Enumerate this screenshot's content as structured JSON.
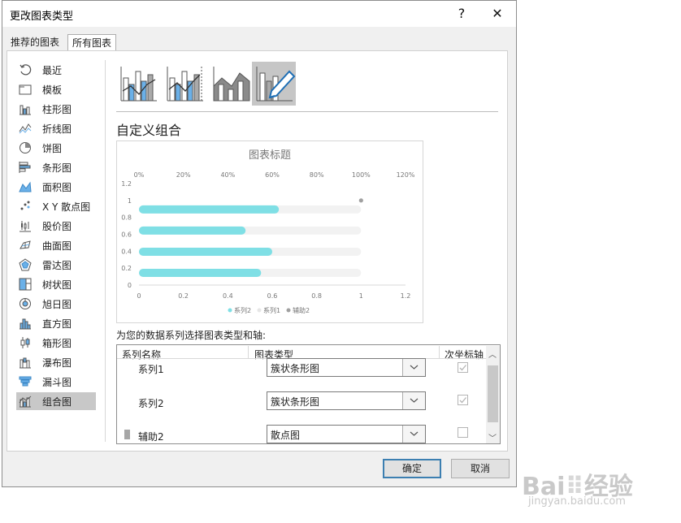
{
  "window": {
    "title": "更改图表类型",
    "help_label": "?",
    "close_label": "✕"
  },
  "tabs": [
    {
      "label": "推荐的图表"
    },
    {
      "label": "所有图表"
    }
  ],
  "sidebar": {
    "items": [
      {
        "label": "最近",
        "icon": "recent-icon"
      },
      {
        "label": "模板",
        "icon": "template-folder-icon"
      },
      {
        "label": "柱形图",
        "icon": "column-chart-icon"
      },
      {
        "label": "折线图",
        "icon": "line-chart-icon"
      },
      {
        "label": "饼图",
        "icon": "pie-chart-icon"
      },
      {
        "label": "条形图",
        "icon": "bar-chart-icon"
      },
      {
        "label": "面积图",
        "icon": "area-chart-icon"
      },
      {
        "label": "X Y 散点图",
        "icon": "scatter-chart-icon"
      },
      {
        "label": "股价图",
        "icon": "stock-chart-icon"
      },
      {
        "label": "曲面图",
        "icon": "surface-chart-icon"
      },
      {
        "label": "雷达图",
        "icon": "radar-chart-icon"
      },
      {
        "label": "树状图",
        "icon": "treemap-chart-icon"
      },
      {
        "label": "旭日图",
        "icon": "sunburst-chart-icon"
      },
      {
        "label": "直方图",
        "icon": "histogram-chart-icon"
      },
      {
        "label": "箱形图",
        "icon": "box-whisker-chart-icon"
      },
      {
        "label": "瀑布图",
        "icon": "waterfall-chart-icon"
      },
      {
        "label": "漏斗图",
        "icon": "funnel-chart-icon"
      },
      {
        "label": "组合图",
        "icon": "combo-chart-icon"
      }
    ],
    "selected": "组合图"
  },
  "combo_subtypes": [
    "clustered-column-line-icon",
    "clustered-column-line-secondary-axis-icon",
    "stacked-area-clustered-column-icon",
    "custom-combination-icon"
  ],
  "section": {
    "title": "自定义组合"
  },
  "chart_data": {
    "type": "bar",
    "title": "图表标题",
    "series": [
      {
        "name": "系列2",
        "values": [
          0.55,
          0.6,
          0.48,
          0.63
        ],
        "color": "#7fdfe5"
      },
      {
        "name": "系列1",
        "values": [
          1,
          1,
          1,
          1
        ],
        "color": "#f2f2f2"
      },
      {
        "name": "辅助2",
        "type": "scatter",
        "points": [
          [
            1,
            1
          ]
        ],
        "color": "#a0a0a0"
      }
    ],
    "bottom_axis": {
      "ticks": [
        "0",
        "0.2",
        "0.4",
        "0.6",
        "0.8",
        "1",
        "1.2"
      ],
      "range": [
        0,
        1.2
      ]
    },
    "top_axis": {
      "ticks": [
        "0%",
        "20%",
        "40%",
        "60%",
        "80%",
        "100%",
        "120%"
      ],
      "range": [
        0,
        1.2
      ]
    },
    "left_axis": {
      "ticks": [
        "0",
        "0.2",
        "0.4",
        "0.6",
        "0.8",
        "1",
        "1.2"
      ],
      "range": [
        0,
        1.2
      ]
    },
    "legend_placement": "bottom",
    "grid": false
  },
  "series_table": {
    "prompt": "为您的数据系列选择图表类型和轴:",
    "headers": {
      "name": "系列名称",
      "type": "图表类型",
      "secondary": "次坐标轴"
    },
    "rows": [
      {
        "name": "系列1",
        "type": "簇状条形图",
        "secondary": true
      },
      {
        "name": "系列2",
        "type": "簇状条形图",
        "secondary": true
      },
      {
        "name": "辅助2",
        "type": "散点图",
        "secondary": false
      }
    ]
  },
  "buttons": {
    "ok": "确定",
    "cancel": "取消"
  },
  "watermark": {
    "brand": "Bai",
    "brand2": "经验",
    "url": "jingyan.baidu.com"
  }
}
